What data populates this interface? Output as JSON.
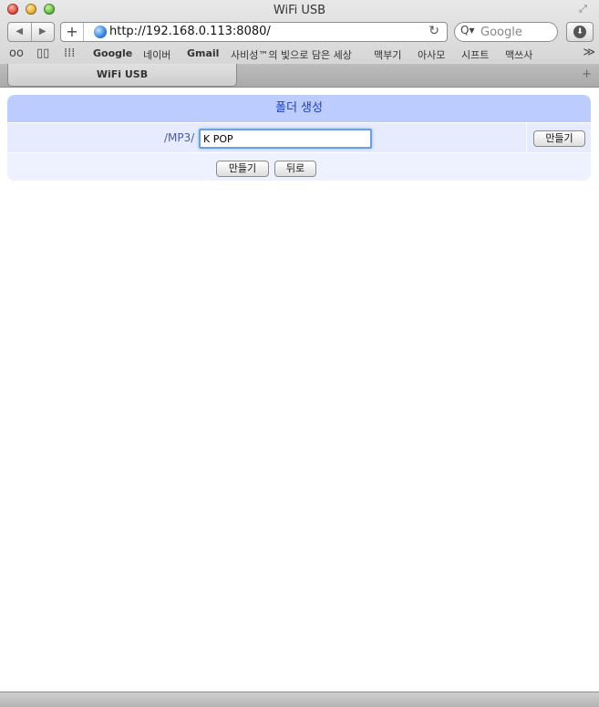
{
  "window": {
    "title": "WiFi USB"
  },
  "nav": {
    "back_glyph": "◀",
    "forward_glyph": "▶",
    "add_glyph": "+",
    "url": "http://192.168.0.113:8080/",
    "reload_glyph": "↻",
    "search_placeholder": "Google",
    "search_glyph": "Q▾",
    "download_glyph": "⬇"
  },
  "bookmarks": {
    "reading_list_glyph": "oo",
    "bookmarks_glyph": "▯▯",
    "topsites_glyph": "⁞⁞⁞",
    "items": [
      "Google",
      "네이버",
      "Gmail",
      "사비성™의 빛으로 담은 세상",
      "맥부기",
      "아사모",
      "시프트",
      "맥쓰사"
    ],
    "more_glyph": "≫"
  },
  "tabs": {
    "active_label": "WiFi USB",
    "new_tab_glyph": "+"
  },
  "folder_form": {
    "header": "폴더 생성",
    "path_label": "/MP3/",
    "name_value": "K POP",
    "make_button_inline": "만들기",
    "make_button": "만들기",
    "back_button": "뒤로"
  },
  "colors": {
    "panel_header": "#bcccff",
    "panel_row": "#e6ebfe",
    "header_text": "#1a3fbf"
  }
}
